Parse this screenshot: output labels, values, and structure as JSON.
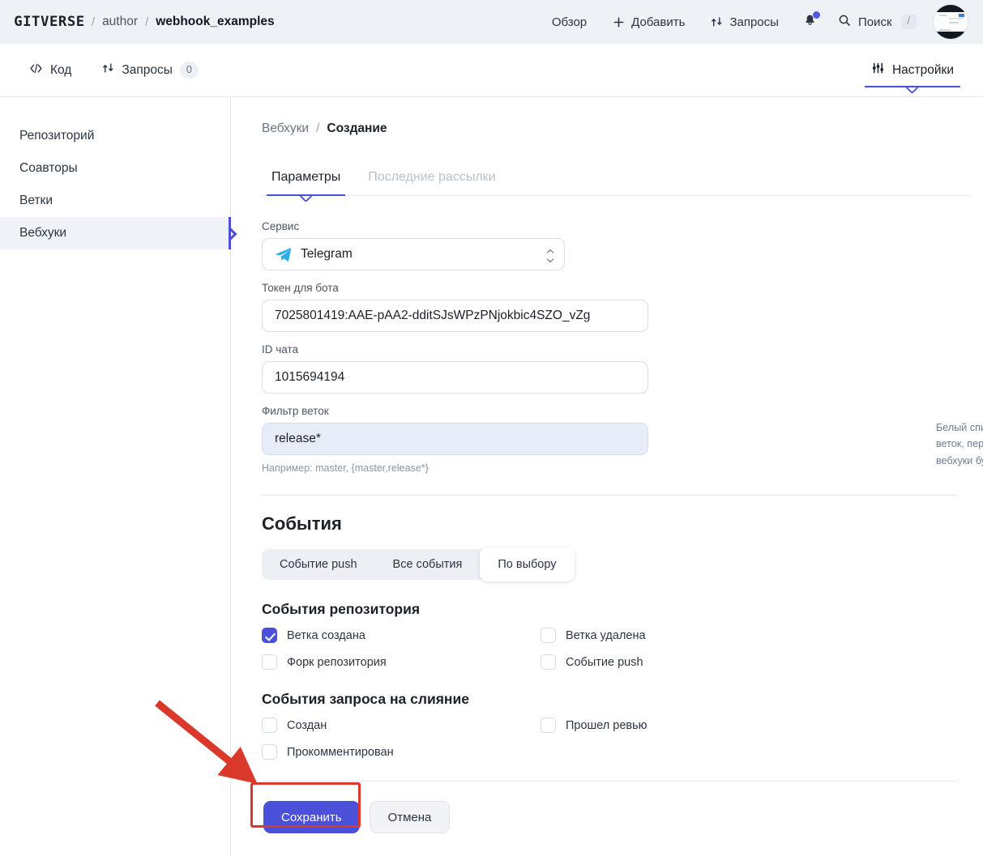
{
  "header": {
    "logo": "GITVERSE",
    "separator": "/",
    "owner": "author",
    "repo": "webhook_examples",
    "nav": [
      {
        "label": "Обзор",
        "icon": ""
      },
      {
        "label": "Добавить",
        "icon": "plus-icon"
      },
      {
        "label": "Запросы",
        "icon": "pull-request-icon"
      }
    ],
    "notifications_icon": "bell-icon",
    "search_label": "Поиск",
    "search_shortcut": "/",
    "avatar": "user-avatar"
  },
  "repo_tabs": {
    "left": [
      {
        "label": "Код",
        "icon": "code-icon",
        "count": null,
        "active": false
      },
      {
        "label": "Запросы",
        "icon": "pull-request-icon",
        "count": "0",
        "active": false
      }
    ],
    "right": {
      "label": "Настройки",
      "icon": "sliders-icon",
      "active": true
    }
  },
  "sidebar": {
    "items": [
      {
        "label": "Репозиторий",
        "active": false
      },
      {
        "label": "Соавторы",
        "active": false
      },
      {
        "label": "Ветки",
        "active": false
      },
      {
        "label": "Вебхуки",
        "active": true
      }
    ]
  },
  "breadcrumb": {
    "parent": "Вебхуки",
    "separator": "/",
    "current": "Создание"
  },
  "subtabs": [
    {
      "label": "Параметры",
      "active": true
    },
    {
      "label": "Последние рассылки",
      "active": false
    }
  ],
  "form": {
    "service": {
      "label": "Сервис",
      "value": "Telegram",
      "icon": "telegram-icon"
    },
    "token": {
      "label": "Токен для бота",
      "value": "7025801419:AAE-pAA2-dditSJsWPzPNjokbic4SZO_vZg",
      "placeholder": "Токен для бота"
    },
    "chat_id": {
      "label": "ID чата",
      "value": "1015694194",
      "placeholder": "ID чата"
    },
    "branch_filter": {
      "label": "Фильтр веток",
      "value": "release*",
      "placeholder": "master",
      "hint": "Например: master, {master,release*}",
      "side_note": "Белый список веток для событий Push, создания и удаления веток, перечисленных через запятую. Если пустой или *, то вебхуки будут срабатывать для всех событий и всех веток."
    }
  },
  "events": {
    "title": "События",
    "segmented": [
      {
        "label": "Событие push",
        "selected": false
      },
      {
        "label": "Все события",
        "selected": false
      },
      {
        "label": "По выбору",
        "selected": true
      }
    ],
    "groups": [
      {
        "title": "События репозитория",
        "items": [
          {
            "label": "Ветка создана",
            "checked": true
          },
          {
            "label": "Ветка удалена",
            "checked": false
          },
          {
            "label": "Форк репозитория",
            "checked": false
          },
          {
            "label": "Событие push",
            "checked": false
          }
        ]
      },
      {
        "title": "События запроса на слияние",
        "items": [
          {
            "label": "Создан",
            "checked": false
          },
          {
            "label": "Прошел ревью",
            "checked": false
          },
          {
            "label": "Прокомментирован",
            "checked": false
          }
        ]
      }
    ]
  },
  "actions": {
    "save_label": "Сохранить",
    "cancel_label": "Отмена"
  },
  "colors": {
    "accent": "#4b50d8",
    "telegram": "#2aabee",
    "annotation": "#d9382a",
    "header_bg": "#eef1f5",
    "active_sidebar_bg": "#eff2f6"
  }
}
